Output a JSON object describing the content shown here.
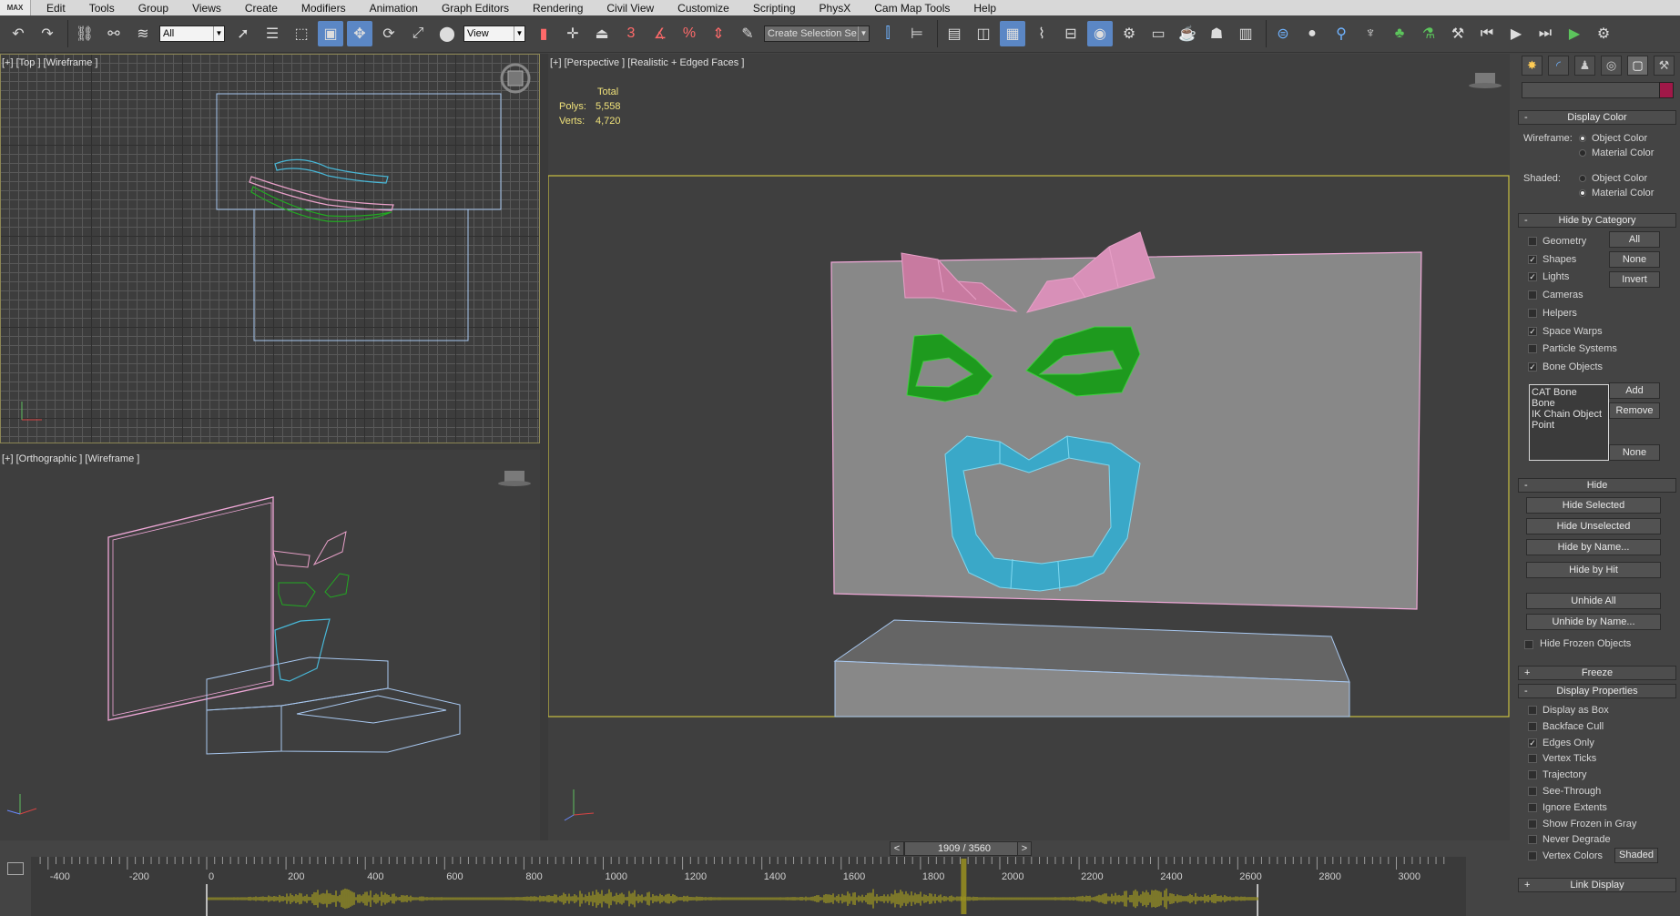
{
  "app": {
    "logo": "MAX"
  },
  "menu": [
    "Edit",
    "Tools",
    "Group",
    "Views",
    "Create",
    "Modifiers",
    "Animation",
    "Graph Editors",
    "Rendering",
    "Civil View",
    "Customize",
    "Scripting",
    "PhysX",
    "Cam Map Tools",
    "Help"
  ],
  "toolbar": {
    "filter_value": "All",
    "ref_coord_value": "View",
    "selection_set_placeholder": "Create Selection Se",
    "snap_label": "3"
  },
  "viewports": {
    "top": {
      "label": "[+] [Top ] [Wireframe ]"
    },
    "ortho": {
      "label": "[+] [Orthographic ] [Wireframe ]"
    },
    "perspective": {
      "label": "[+] [Perspective ] [Realistic + Edged Faces ]",
      "stats": {
        "header": "Total",
        "polys_label": "Polys:",
        "polys_value": "5,558",
        "verts_label": "Verts:",
        "verts_value": "4,720"
      }
    }
  },
  "command_panel": {
    "display_color": {
      "title": "Display Color",
      "wireframe_label": "Wireframe:",
      "shaded_label": "Shaded:",
      "object_color": "Object Color",
      "material_color": "Material Color",
      "wireframe_selected": "Object Color",
      "shaded_selected": "Material Color"
    },
    "hide_by_category": {
      "title": "Hide by Category",
      "items": [
        {
          "label": "Geometry",
          "checked": false
        },
        {
          "label": "Shapes",
          "checked": true
        },
        {
          "label": "Lights",
          "checked": true
        },
        {
          "label": "Cameras",
          "checked": false
        },
        {
          "label": "Helpers",
          "checked": false
        },
        {
          "label": "Space Warps",
          "checked": true
        },
        {
          "label": "Particle Systems",
          "checked": false
        },
        {
          "label": "Bone Objects",
          "checked": true
        }
      ],
      "btn_all": "All",
      "btn_none": "None",
      "btn_invert": "Invert",
      "list": [
        "CAT Bone",
        "Bone",
        "IK Chain Object",
        "Point"
      ],
      "btn_add": "Add",
      "btn_remove": "Remove",
      "btn_none2": "None"
    },
    "hide": {
      "title": "Hide",
      "buttons": [
        "Hide Selected",
        "Hide Unselected",
        "Hide by Name...",
        "Hide by Hit",
        "Unhide All",
        "Unhide by Name..."
      ],
      "hide_frozen": "Hide Frozen Objects"
    },
    "freeze": {
      "title": "Freeze"
    },
    "display_properties": {
      "title": "Display Properties",
      "items": [
        {
          "label": "Display as Box",
          "checked": false
        },
        {
          "label": "Backface Cull",
          "checked": false
        },
        {
          "label": "Edges Only",
          "checked": true
        },
        {
          "label": "Vertex Ticks",
          "checked": false
        },
        {
          "label": "Trajectory",
          "checked": false
        },
        {
          "label": "See-Through",
          "checked": false
        },
        {
          "label": "Ignore Extents",
          "checked": false
        },
        {
          "label": "Show Frozen in Gray",
          "checked": false
        },
        {
          "label": "Never Degrade",
          "checked": false
        },
        {
          "label": "Vertex Colors",
          "checked": false
        }
      ],
      "shaded_btn": "Shaded"
    },
    "link_display": {
      "title": "Link Display"
    }
  },
  "timeslider": {
    "frame": "1909 / 3560",
    "prev": "<",
    "next": ">"
  },
  "timeline": {
    "ticks": [
      -400,
      -200,
      0,
      200,
      400,
      600,
      800,
      1000,
      1200,
      1400,
      1600,
      1800,
      2000,
      2200,
      2400,
      2600,
      2800,
      3000
    ],
    "current_frame": 1909,
    "range_start": 0,
    "range_end": 2650
  },
  "colors": {
    "brow": "#e8a0c8",
    "eyes": "#22aa22",
    "mouth": "#48b8d8",
    "plane_edge": "#f0a8d8",
    "box_edge": "#a8c8f0",
    "selection_frame": "#c8c040",
    "audio": "#a8a020"
  }
}
